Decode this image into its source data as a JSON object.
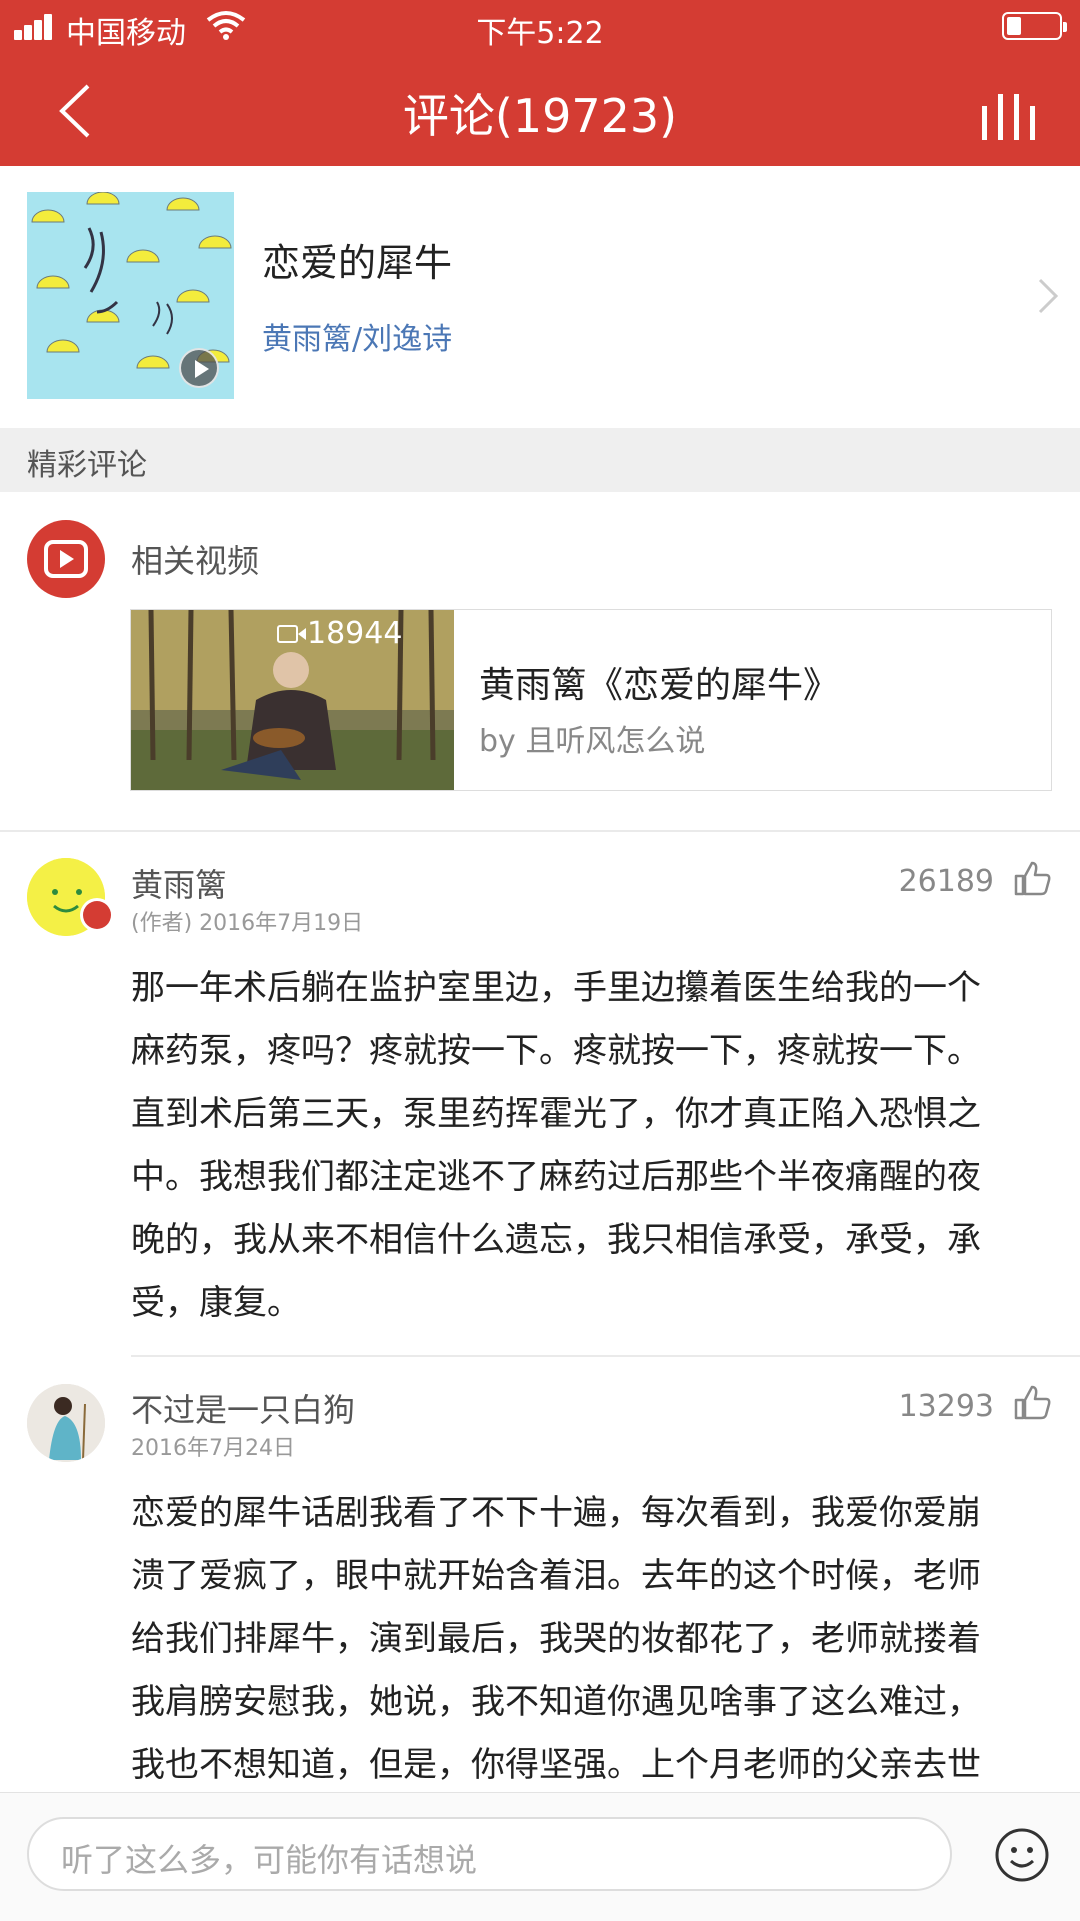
{
  "status_bar": {
    "carrier": "中国移动",
    "time": "下午5:22"
  },
  "nav": {
    "title": "评论(19723)"
  },
  "song": {
    "title": "恋爱的犀牛",
    "artist": "黄雨篱/刘逸诗"
  },
  "section": {
    "hot_comments": "精彩评论"
  },
  "related": {
    "label": "相关视频",
    "video": {
      "play_count": "18944",
      "title": "黄雨篱《恋爱的犀牛》",
      "by": "by 且听风怎么说"
    }
  },
  "comments": [
    {
      "name": "黄雨篱",
      "tag": "(作者)",
      "date": "2016年7月19日",
      "likes": "26189",
      "text_lines": [
        "那一年术后躺在监护室里边，手里边攥着医生给我的一个",
        "麻药泵，疼吗？疼就按一下。疼就按一下，疼就按一下。",
        "直到术后第三天，泵里药挥霍光了，你才真正陷入恐惧之",
        "中。我想我们都注定逃不了麻药过后那些个半夜痛醒的夜",
        "晚的，我从来不相信什么遗忘，我只相信承受，承受，承",
        "受，康复。"
      ]
    },
    {
      "name": "不过是一只白狗",
      "date": "2016年7月24日",
      "likes": "13293",
      "text_lines": [
        "恋爱的犀牛话剧我看了不下十遍，每次看到，我爱你爱崩",
        "溃了爱疯了，眼中就开始含着泪。去年的这个时候，老师",
        "给我们排犀牛，演到最后，我哭的妆都花了，老师就搂着",
        "我肩膀安慰我，她说，我不知道你遇见啥事了这么难过，",
        "我也不想知道，但是，你得坚强。上个月老师的父亲去世"
      ]
    }
  ],
  "input": {
    "placeholder": "听了这么多，可能你有话想说"
  },
  "colors": {
    "brand": "#d43c33",
    "link": "#4b77b5"
  },
  "icons": [
    "signal-icon",
    "wifi-icon",
    "battery-icon",
    "back-icon",
    "playlist-icon",
    "play-icon",
    "chevron-right-icon",
    "video-icon",
    "camera-icon",
    "author-badge-icon",
    "thumb-up-icon",
    "emoji-icon"
  ]
}
